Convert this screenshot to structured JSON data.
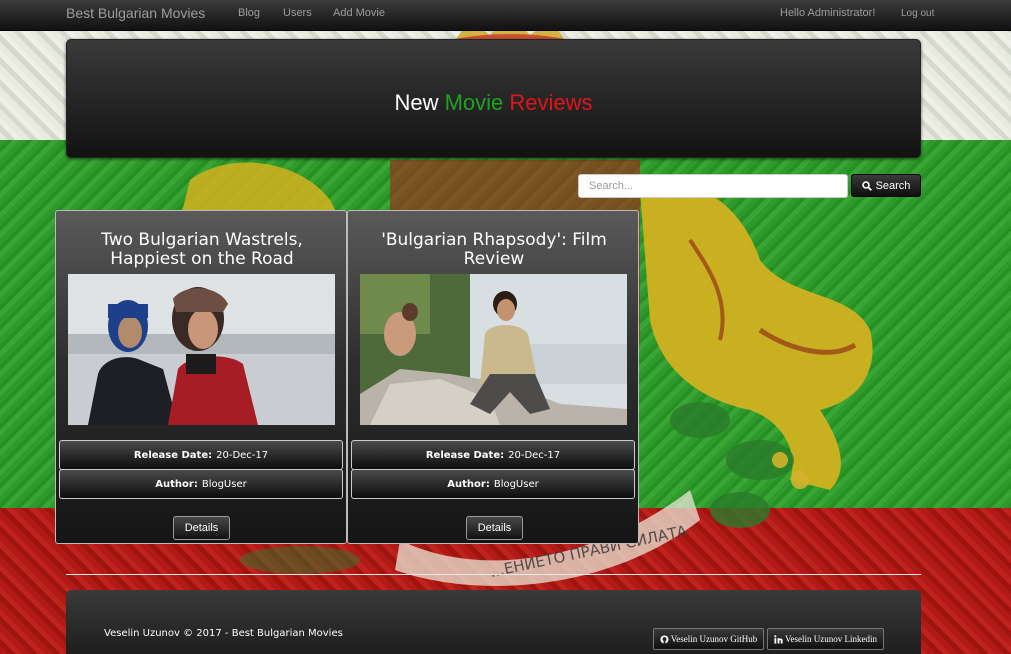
{
  "navbar": {
    "brand": "Best Bulgarian Movies",
    "links": [
      "Blog",
      "Users",
      "Add Movie"
    ],
    "greeting": "Hello Administrator!",
    "logout": "Log out"
  },
  "jumbotron": {
    "word1": "New",
    "word2": "Movie",
    "word3": "Reviews"
  },
  "search": {
    "placeholder": "Search...",
    "button_label": "Search"
  },
  "movies": [
    {
      "title": "Two Bulgarian Wastrels, Happiest on the Road",
      "release_label": "Release Date:",
      "release_date": "20-Dec-17",
      "author_label": "Author:",
      "author": "BlogUser",
      "details_label": "Details"
    },
    {
      "title": "'Bulgarian Rhapsody': Film Review",
      "release_label": "Release Date:",
      "release_date": "20-Dec-17",
      "author_label": "Author:",
      "author": "BlogUser",
      "details_label": "Details"
    }
  ],
  "footer": {
    "copyright": "Veselin Uzunov © 2017 - Best Bulgarian Movies",
    "github_label": "Veselin Uzunov GitHub",
    "linkedin_label": "Veselin Uzunov Linkedin"
  },
  "background_text": "...ЕНИЕТО ПРАВИ СИЛАТА",
  "colors": {
    "flag_white": "#e7eadf",
    "flag_green": "#2f9a2c",
    "flag_red": "#b11a16",
    "accent_green": "#1fa31f",
    "accent_red": "#e0151a"
  }
}
